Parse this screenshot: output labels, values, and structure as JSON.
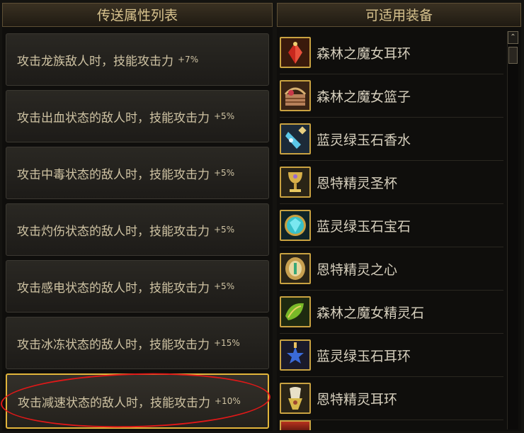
{
  "left_panel": {
    "title": "传送属性列表",
    "rows": [
      {
        "text": "攻击龙族敌人时，技能攻击力",
        "bonus": "+7%"
      },
      {
        "text": "攻击出血状态的敌人时，技能攻击力",
        "bonus": "+5%"
      },
      {
        "text": "攻击中毒状态的敌人时，技能攻击力",
        "bonus": "+5%"
      },
      {
        "text": "攻击灼伤状态的敌人时，技能攻击力",
        "bonus": "+5%"
      },
      {
        "text": "攻击感电状态的敌人时，技能攻击力",
        "bonus": "+5%"
      },
      {
        "text": "攻击冰冻状态的敌人时，技能攻击力",
        "bonus": "+15%"
      },
      {
        "text": "攻击减速状态的敌人时，技能攻击力",
        "bonus": "+10%",
        "selected": true
      }
    ]
  },
  "right_panel": {
    "title": "可适用装备",
    "items": [
      {
        "name": "森林之魔女耳环",
        "icon": "ruby-earring-icon",
        "color": "#c8281e"
      },
      {
        "name": "森林之魔女篮子",
        "icon": "basket-icon",
        "color": "#b7815a"
      },
      {
        "name": "蓝灵绿玉石香水",
        "icon": "perfume-bottle-icon",
        "color": "#5cc8e8"
      },
      {
        "name": "恩特精灵圣杯",
        "icon": "chalice-icon",
        "color": "#d8b04a"
      },
      {
        "name": "蓝灵绿玉石宝石",
        "icon": "cyan-gem-icon",
        "color": "#38c0c8"
      },
      {
        "name": "恩特精灵之心",
        "icon": "heart-ornament-icon",
        "color": "#c8a050"
      },
      {
        "name": "森林之魔女精灵石",
        "icon": "green-stone-icon",
        "color": "#78b828"
      },
      {
        "name": "蓝灵绿玉石耳环",
        "icon": "blue-star-earring-icon",
        "color": "#3a6ad8"
      },
      {
        "name": "恩特精灵耳环",
        "icon": "gold-earring-icon",
        "color": "#d8b84a"
      }
    ],
    "scroll_up_glyph": "⌃"
  }
}
